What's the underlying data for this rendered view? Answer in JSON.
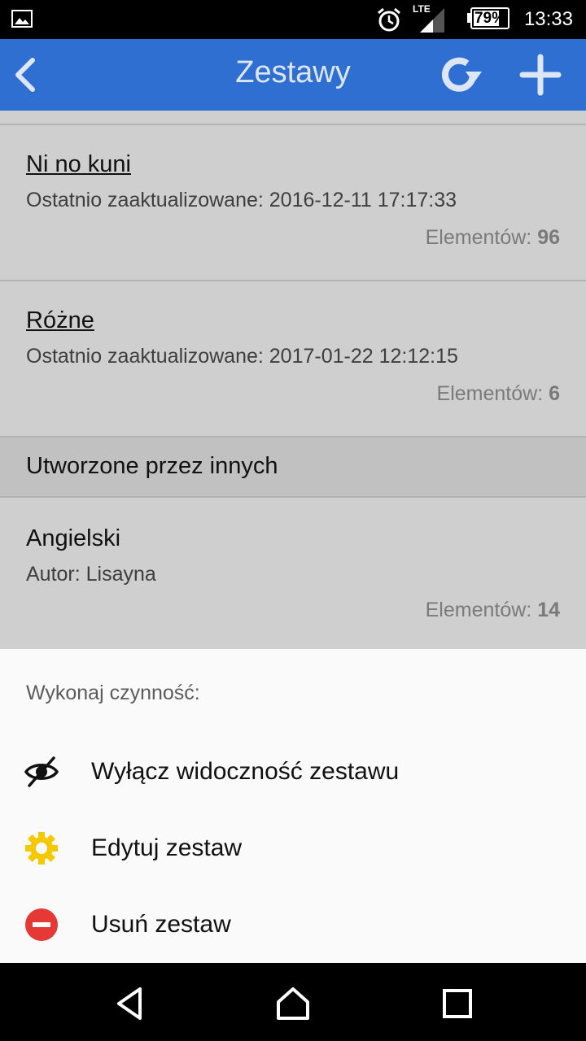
{
  "status_bar": {
    "network": "LTE",
    "battery": "79%",
    "battery_level": 0.79,
    "time": "13:33"
  },
  "app_bar": {
    "title": "Zestawy"
  },
  "sets": [
    {
      "title": "Ni no kuni",
      "subtitle": "Ostatnio zaaktualizowane: 2016-12-11 17:17:33",
      "count_label": "Elementów:",
      "count": "96"
    },
    {
      "title": "Różne",
      "subtitle": "Ostatnio zaaktualizowane: 2017-01-22 12:12:15",
      "count_label": "Elementów:",
      "count": "6"
    }
  ],
  "others_section": {
    "title": "Utworzone przez innych",
    "items": [
      {
        "title": "Angielski",
        "subtitle": "Autor: Lisayna",
        "count_label": "Elementów:",
        "count": "14"
      }
    ]
  },
  "action_sheet": {
    "heading": "Wykonaj czynność:",
    "actions": [
      {
        "label": "Wyłącz widoczność zestawu",
        "icon": "eye-off-icon"
      },
      {
        "label": "Edytuj zestaw",
        "icon": "gear-icon",
        "color": "#f5c800"
      },
      {
        "label": "Usuń zestaw",
        "icon": "remove-circle-icon",
        "color": "#e53935"
      }
    ]
  },
  "colors": {
    "app_bar": "#2f6fd1",
    "list_background": "#cfcfcf",
    "sheet_background": "#fafafa"
  }
}
